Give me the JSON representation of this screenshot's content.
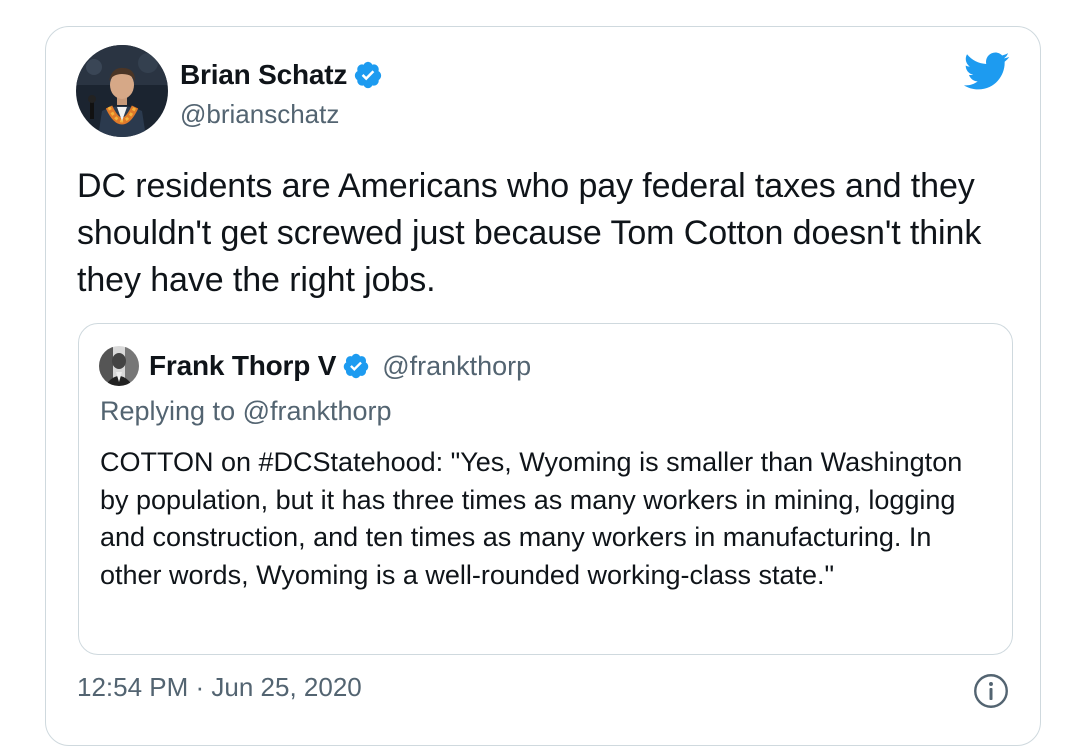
{
  "tweet": {
    "author": {
      "name": "Brian Schatz",
      "handle": "@brianschatz",
      "verified": true,
      "avatar_icon": "avatar-photo"
    },
    "text": "DC residents are Americans who pay federal taxes and they shouldn't get screwed just because Tom Cotton doesn't think they have the right jobs.",
    "timestamp": "12:54 PM · Jun 25, 2020",
    "brand_icon": "twitter-bird-icon",
    "info_icon": "info-icon"
  },
  "quoted_tweet": {
    "author": {
      "name": "Frank Thorp V",
      "handle": "@frankthorp",
      "verified": true
    },
    "replying_to": "Replying to @frankthorp",
    "text": "COTTON on #DCStatehood: \"Yes, Wyoming is smaller than Washington by population, but it has three times as many workers in mining, logging and construction, and ten times as many workers in manufacturing. In other words, Wyoming is a well-rounded working-class state.\""
  },
  "colors": {
    "twitter_blue": "#1d9bf0",
    "text_primary": "#0f1419",
    "text_secondary": "#536471",
    "border": "#cfd9de"
  }
}
